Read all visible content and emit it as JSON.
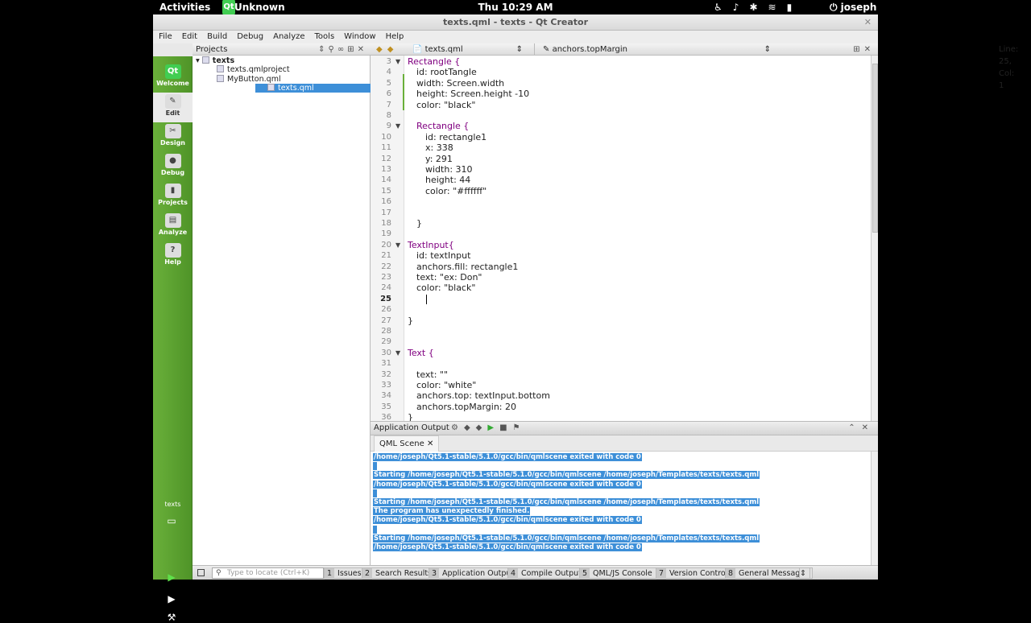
{
  "topbar": {
    "activities": "Activities",
    "app_name": "Unknown",
    "clock": "Thu 10:29 AM",
    "user": "joseph"
  },
  "window": {
    "title": "texts.qml - texts - Qt Creator"
  },
  "menu": [
    "File",
    "Edit",
    "Build",
    "Debug",
    "Analyze",
    "Tools",
    "Window",
    "Help"
  ],
  "modes": [
    {
      "label": "Welcome",
      "icon": "qt-logo-icon"
    },
    {
      "label": "Edit",
      "icon": "edit-icon"
    },
    {
      "label": "Design",
      "icon": "design-icon"
    },
    {
      "label": "Debug",
      "icon": "debug-icon"
    },
    {
      "label": "Projects",
      "icon": "projects-icon"
    },
    {
      "label": "Analyze",
      "icon": "analyze-icon"
    },
    {
      "label": "Help",
      "icon": "help-icon"
    }
  ],
  "kit": {
    "label": "texts"
  },
  "projects": {
    "header": "Projects",
    "tree": [
      {
        "label": "texts",
        "level": 0,
        "selected": false
      },
      {
        "label": "texts.qmlproject",
        "level": 1,
        "selected": false
      },
      {
        "label": "MyButton.qml",
        "level": 1,
        "selected": false
      },
      {
        "label": "texts.qml",
        "level": 1,
        "selected": true
      }
    ]
  },
  "editor": {
    "file": "texts.qml",
    "symbol": "anchors.topMargin",
    "position": "Line: 25, Col: 1",
    "current_line": 25,
    "lines": [
      {
        "n": 3,
        "text": "Rectangle {",
        "fold": true
      },
      {
        "n": 4,
        "text": "id: rootTangle"
      },
      {
        "n": 5,
        "text": "width: Screen.width"
      },
      {
        "n": 6,
        "text": "height: Screen.height -10"
      },
      {
        "n": 7,
        "text": "color: \"black\""
      },
      {
        "n": 8,
        "text": ""
      },
      {
        "n": 9,
        "text": "Rectangle {",
        "fold": true
      },
      {
        "n": 10,
        "text": "id: rectangle1"
      },
      {
        "n": 11,
        "text": "x: 338"
      },
      {
        "n": 12,
        "text": "y: 291"
      },
      {
        "n": 13,
        "text": "width: 310"
      },
      {
        "n": 14,
        "text": "height: 44"
      },
      {
        "n": 15,
        "text": "color: \"#ffffff\""
      },
      {
        "n": 16,
        "text": ""
      },
      {
        "n": 17,
        "text": ""
      },
      {
        "n": 18,
        "text": "}"
      },
      {
        "n": 19,
        "text": ""
      },
      {
        "n": 20,
        "text": "TextInput{",
        "fold": true
      },
      {
        "n": 21,
        "text": "id: textInput"
      },
      {
        "n": 22,
        "text": "anchors.fill: rectangle1"
      },
      {
        "n": 23,
        "text": "text: \"ex: Don\""
      },
      {
        "n": 24,
        "text": "color: \"black\""
      },
      {
        "n": 25,
        "text": ""
      },
      {
        "n": 26,
        "text": ""
      },
      {
        "n": 27,
        "text": "}"
      },
      {
        "n": 28,
        "text": ""
      },
      {
        "n": 29,
        "text": ""
      },
      {
        "n": 30,
        "text": "Text {",
        "fold": true
      },
      {
        "n": 31,
        "text": ""
      },
      {
        "n": 32,
        "text": "text: \"\""
      },
      {
        "n": 33,
        "text": "color: \"white\""
      },
      {
        "n": 34,
        "text": "anchors.top: textInput.bottom"
      },
      {
        "n": 35,
        "text": "anchors.topMargin: 20"
      },
      {
        "n": 36,
        "text": "}"
      }
    ]
  },
  "output": {
    "title": "Application Output",
    "tab": "QML Scene",
    "lines": [
      "/home/joseph/Qt5.1-stable/5.1.0/gcc/bin/qmlscene exited with code 0",
      " ",
      "Starting /home/joseph/Qt5.1-stable/5.1.0/gcc/bin/qmlscene /home/joseph/Templates/texts/texts.qml",
      "/home/joseph/Qt5.1-stable/5.1.0/gcc/bin/qmlscene exited with code 0",
      " ",
      "Starting /home/joseph/Qt5.1-stable/5.1.0/gcc/bin/qmlscene /home/joseph/Templates/texts/texts.qml",
      "The program has unexpectedly finished.",
      "/home/joseph/Qt5.1-stable/5.1.0/gcc/bin/qmlscene exited with code 0",
      " ",
      "Starting /home/joseph/Qt5.1-stable/5.1.0/gcc/bin/qmlscene /home/joseph/Templates/texts/texts.qml",
      "/home/joseph/Qt5.1-stable/5.1.0/gcc/bin/qmlscene exited with code 0"
    ]
  },
  "statusbar": {
    "locator_placeholder": "Type to locate (Ctrl+K)",
    "panes": [
      {
        "num": "1",
        "label": "Issues"
      },
      {
        "num": "2",
        "label": "Search Results"
      },
      {
        "num": "3",
        "label": "Application Output"
      },
      {
        "num": "4",
        "label": "Compile Output"
      },
      {
        "num": "5",
        "label": "QML/JS Console"
      },
      {
        "num": "7",
        "label": "Version Control"
      },
      {
        "num": "8",
        "label": "General Messages"
      }
    ]
  }
}
